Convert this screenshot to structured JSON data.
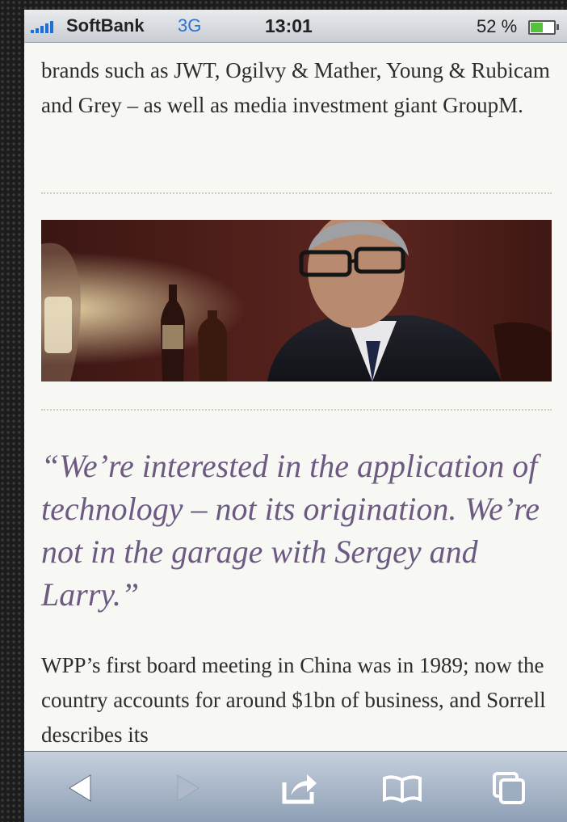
{
  "status_bar": {
    "carrier": "SoftBank",
    "network": "3G",
    "time": "13:01",
    "battery_percent": "52 %",
    "battery_level": 0.52
  },
  "article": {
    "paragraph_1": "brands such as JWT, Ogilvy & Mather, Young & Rubicam and Grey – as well as media investment giant GroupM.",
    "quote": "“We’re interested in the application of technology – not its origination. We’re not in the garage with Sergey and Larry.”",
    "paragraph_2": "WPP’s first board meeting in China was in 1989; now the country accounts for around $1bn of business, and Sorrell describes its"
  },
  "toolbar": {
    "buttons": [
      {
        "icon": "back-arrow-icon",
        "enabled": true
      },
      {
        "icon": "forward-arrow-icon",
        "enabled": false
      },
      {
        "icon": "share-icon",
        "enabled": true
      },
      {
        "icon": "bookmarks-icon",
        "enabled": true
      },
      {
        "icon": "pages-icon",
        "enabled": true
      }
    ]
  },
  "colors": {
    "quote": "#6d5a82",
    "body_text": "#2d2d2d",
    "page_background": "#f7f7f3",
    "network_indicator": "#2a73d6",
    "battery_fill": "#56c13d"
  }
}
